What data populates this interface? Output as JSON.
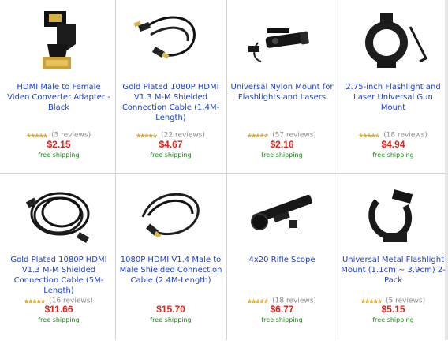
{
  "colors": {
    "title": "#1a3fd6",
    "price": "#e3241c",
    "shipping": "#1b8a16",
    "reviews": "#8a8a8a",
    "divider": "#d4d4d4"
  },
  "products": [
    {
      "title": "HDMI Male to Female Video Converter Adapter - Black",
      "rating": 5,
      "reviews": "(3 reviews)",
      "price": "$2.15",
      "shipping": "free shipping",
      "image": "hdmi-adapter"
    },
    {
      "title": "Gold Plated 1080P HDMI V1.3 M-M Shielded Connection Cable (1.4M-Length)",
      "rating": 4.5,
      "reviews": "(22 reviews)",
      "price": "$4.67",
      "shipping": "free shipping",
      "image": "hdmi-cable-short"
    },
    {
      "title": "Universal Nylon Mount for Flashlights and Lasers",
      "rating": 4.5,
      "reviews": "(57 reviews)",
      "price": "$2.16",
      "shipping": "free shipping",
      "image": "flashlight-mount"
    },
    {
      "title": "2.75-inch Flashlight and Laser Universal Gun Mount",
      "rating": 4.5,
      "reviews": "(18 reviews)",
      "price": "$4.94",
      "shipping": "free shipping",
      "image": "gun-mount"
    },
    {
      "title": "Gold Plated 1080P HDMI V1.3 M-M Shielded Connection Cable (5M-Length)",
      "rating": 4.5,
      "reviews": "(16 reviews)",
      "price": "$11.66",
      "shipping": "free shipping",
      "image": "hdmi-cable-coil"
    },
    {
      "title": "1080P HDMI V1.4 Male to Male Shielded Connection Cable (2.4M-Length)",
      "rating": null,
      "reviews": "",
      "price": "$15.70",
      "shipping": "free shipping",
      "image": "hdmi-cable-gold"
    },
    {
      "title": "4x20 Rifle Scope",
      "rating": 4.5,
      "reviews": "(18 reviews)",
      "price": "$6.77",
      "shipping": "free shipping",
      "image": "rifle-scope"
    },
    {
      "title": "Universal Metal Flashlight Mount (1.1cm ~ 3.9cm) 2-Pack",
      "rating": 4.5,
      "reviews": "(5 reviews)",
      "price": "$5.15",
      "shipping": "free shipping",
      "image": "metal-mount"
    }
  ]
}
